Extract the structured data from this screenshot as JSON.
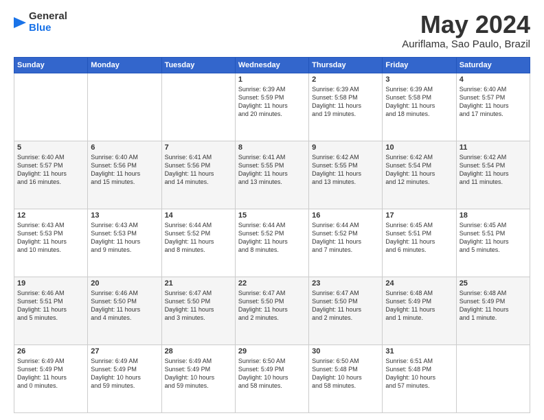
{
  "logo": {
    "line1": "General",
    "line2": "Blue"
  },
  "title": "May 2024",
  "location": "Auriflama, Sao Paulo, Brazil",
  "weekdays": [
    "Sunday",
    "Monday",
    "Tuesday",
    "Wednesday",
    "Thursday",
    "Friday",
    "Saturday"
  ],
  "weeks": [
    [
      {
        "day": "",
        "info": ""
      },
      {
        "day": "",
        "info": ""
      },
      {
        "day": "",
        "info": ""
      },
      {
        "day": "1",
        "info": "Sunrise: 6:39 AM\nSunset: 5:59 PM\nDaylight: 11 hours\nand 20 minutes."
      },
      {
        "day": "2",
        "info": "Sunrise: 6:39 AM\nSunset: 5:58 PM\nDaylight: 11 hours\nand 19 minutes."
      },
      {
        "day": "3",
        "info": "Sunrise: 6:39 AM\nSunset: 5:58 PM\nDaylight: 11 hours\nand 18 minutes."
      },
      {
        "day": "4",
        "info": "Sunrise: 6:40 AM\nSunset: 5:57 PM\nDaylight: 11 hours\nand 17 minutes."
      }
    ],
    [
      {
        "day": "5",
        "info": "Sunrise: 6:40 AM\nSunset: 5:57 PM\nDaylight: 11 hours\nand 16 minutes."
      },
      {
        "day": "6",
        "info": "Sunrise: 6:40 AM\nSunset: 5:56 PM\nDaylight: 11 hours\nand 15 minutes."
      },
      {
        "day": "7",
        "info": "Sunrise: 6:41 AM\nSunset: 5:56 PM\nDaylight: 11 hours\nand 14 minutes."
      },
      {
        "day": "8",
        "info": "Sunrise: 6:41 AM\nSunset: 5:55 PM\nDaylight: 11 hours\nand 13 minutes."
      },
      {
        "day": "9",
        "info": "Sunrise: 6:42 AM\nSunset: 5:55 PM\nDaylight: 11 hours\nand 13 minutes."
      },
      {
        "day": "10",
        "info": "Sunrise: 6:42 AM\nSunset: 5:54 PM\nDaylight: 11 hours\nand 12 minutes."
      },
      {
        "day": "11",
        "info": "Sunrise: 6:42 AM\nSunset: 5:54 PM\nDaylight: 11 hours\nand 11 minutes."
      }
    ],
    [
      {
        "day": "12",
        "info": "Sunrise: 6:43 AM\nSunset: 5:53 PM\nDaylight: 11 hours\nand 10 minutes."
      },
      {
        "day": "13",
        "info": "Sunrise: 6:43 AM\nSunset: 5:53 PM\nDaylight: 11 hours\nand 9 minutes."
      },
      {
        "day": "14",
        "info": "Sunrise: 6:44 AM\nSunset: 5:52 PM\nDaylight: 11 hours\nand 8 minutes."
      },
      {
        "day": "15",
        "info": "Sunrise: 6:44 AM\nSunset: 5:52 PM\nDaylight: 11 hours\nand 8 minutes."
      },
      {
        "day": "16",
        "info": "Sunrise: 6:44 AM\nSunset: 5:52 PM\nDaylight: 11 hours\nand 7 minutes."
      },
      {
        "day": "17",
        "info": "Sunrise: 6:45 AM\nSunset: 5:51 PM\nDaylight: 11 hours\nand 6 minutes."
      },
      {
        "day": "18",
        "info": "Sunrise: 6:45 AM\nSunset: 5:51 PM\nDaylight: 11 hours\nand 5 minutes."
      }
    ],
    [
      {
        "day": "19",
        "info": "Sunrise: 6:46 AM\nSunset: 5:51 PM\nDaylight: 11 hours\nand 5 minutes."
      },
      {
        "day": "20",
        "info": "Sunrise: 6:46 AM\nSunset: 5:50 PM\nDaylight: 11 hours\nand 4 minutes."
      },
      {
        "day": "21",
        "info": "Sunrise: 6:47 AM\nSunset: 5:50 PM\nDaylight: 11 hours\nand 3 minutes."
      },
      {
        "day": "22",
        "info": "Sunrise: 6:47 AM\nSunset: 5:50 PM\nDaylight: 11 hours\nand 2 minutes."
      },
      {
        "day": "23",
        "info": "Sunrise: 6:47 AM\nSunset: 5:50 PM\nDaylight: 11 hours\nand 2 minutes."
      },
      {
        "day": "24",
        "info": "Sunrise: 6:48 AM\nSunset: 5:49 PM\nDaylight: 11 hours\nand 1 minute."
      },
      {
        "day": "25",
        "info": "Sunrise: 6:48 AM\nSunset: 5:49 PM\nDaylight: 11 hours\nand 1 minute."
      }
    ],
    [
      {
        "day": "26",
        "info": "Sunrise: 6:49 AM\nSunset: 5:49 PM\nDaylight: 11 hours\nand 0 minutes."
      },
      {
        "day": "27",
        "info": "Sunrise: 6:49 AM\nSunset: 5:49 PM\nDaylight: 10 hours\nand 59 minutes."
      },
      {
        "day": "28",
        "info": "Sunrise: 6:49 AM\nSunset: 5:49 PM\nDaylight: 10 hours\nand 59 minutes."
      },
      {
        "day": "29",
        "info": "Sunrise: 6:50 AM\nSunset: 5:49 PM\nDaylight: 10 hours\nand 58 minutes."
      },
      {
        "day": "30",
        "info": "Sunrise: 6:50 AM\nSunset: 5:48 PM\nDaylight: 10 hours\nand 58 minutes."
      },
      {
        "day": "31",
        "info": "Sunrise: 6:51 AM\nSunset: 5:48 PM\nDaylight: 10 hours\nand 57 minutes."
      },
      {
        "day": "",
        "info": ""
      }
    ]
  ]
}
